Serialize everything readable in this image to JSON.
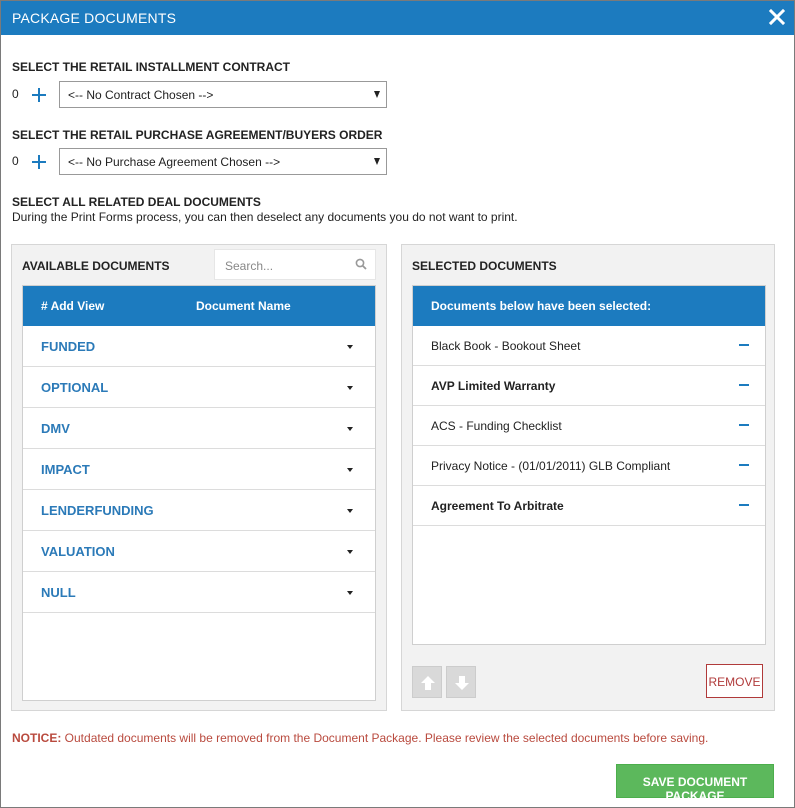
{
  "modal": {
    "title": "PACKAGE DOCUMENTS",
    "close_icon": "close-icon"
  },
  "contract": {
    "label": "SELECT THE RETAIL INSTALLMENT CONTRACT",
    "count": "0",
    "selected": "<-- No Contract Chosen -->"
  },
  "purchase": {
    "label": "SELECT THE RETAIL PURCHASE AGREEMENT/BUYERS ORDER",
    "count": "0",
    "selected": "<-- No Purchase Agreement Chosen -->"
  },
  "related": {
    "label": "SELECT ALL RELATED DEAL DOCUMENTS",
    "help": "During the Print Forms process, you can then deselect any documents you do not want to print."
  },
  "available": {
    "title": "AVAILABLE DOCUMENTS",
    "search_placeholder": "Search...",
    "header_add_view": "# Add View",
    "header_doc_name": "Document Name",
    "categories": [
      {
        "label": "FUNDED"
      },
      {
        "label": "OPTIONAL"
      },
      {
        "label": "DMV"
      },
      {
        "label": "IMPACT"
      },
      {
        "label": "LENDERFUNDING"
      },
      {
        "label": "VALUATION"
      },
      {
        "label": "NULL"
      }
    ]
  },
  "selected": {
    "title": "SELECTED DOCUMENTS",
    "header": "Documents below have been selected:",
    "items": [
      {
        "label": "Black Book - Bookout Sheet",
        "bold": false
      },
      {
        "label": "AVP Limited Warranty",
        "bold": true
      },
      {
        "label": "ACS - Funding Checklist",
        "bold": false
      },
      {
        "label": "Privacy Notice - (01/01/2011) GLB Compliant",
        "bold": false
      },
      {
        "label": "Agreement To Arbitrate",
        "bold": true
      }
    ],
    "remove_label": "REMOVE"
  },
  "notice": {
    "prefix": "NOTICE:",
    "text": " Outdated documents will be removed from the Document Package. Please review the selected documents before saving."
  },
  "save_label": "SAVE DOCUMENT PACKAGE",
  "colors": {
    "primary": "#1c7bbf",
    "save": "#5cb85c",
    "remove": "#b03a3a",
    "notice": "#b94a3e"
  }
}
